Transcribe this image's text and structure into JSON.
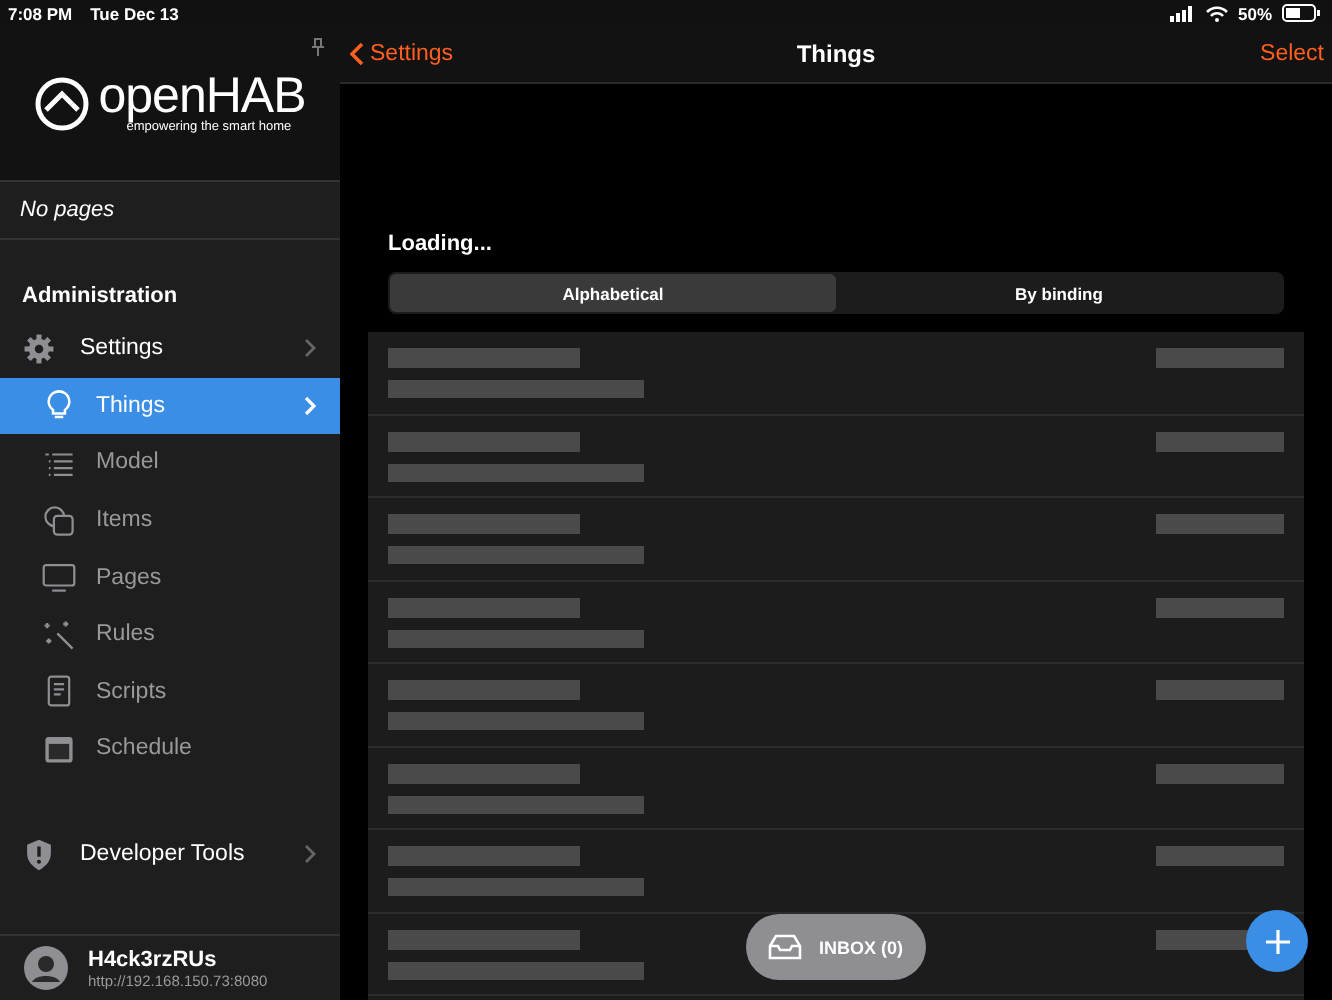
{
  "status_bar": {
    "time": "7:08 PM",
    "date": "Tue Dec 13",
    "battery": "50%"
  },
  "sidebar": {
    "logo": {
      "name": "openHAB",
      "tagline": "empowering the smart home"
    },
    "pages_note": "No pages",
    "section_title": "Administration",
    "items": [
      {
        "label": "Settings",
        "kind": "gear",
        "selected": false,
        "children": [
          {
            "label": "Things",
            "kind": "bulb",
            "selected": true
          },
          {
            "label": "Model",
            "kind": "list",
            "selected": false
          },
          {
            "label": "Items",
            "kind": "squares",
            "selected": false
          },
          {
            "label": "Pages",
            "kind": "monitor",
            "selected": false
          },
          {
            "label": "Rules",
            "kind": "wand",
            "selected": false
          },
          {
            "label": "Scripts",
            "kind": "document",
            "selected": false
          },
          {
            "label": "Schedule",
            "kind": "calendar",
            "selected": false
          }
        ]
      }
    ],
    "developer_tools": {
      "label": "Developer Tools"
    },
    "user": {
      "name": "H4ck3rzRUs",
      "address": "http://192.168.150.73:8080"
    }
  },
  "nav_bar": {
    "back": "Settings",
    "title": "Things",
    "action": "Select"
  },
  "loading_text": "Loading...",
  "tabs": [
    {
      "label": "Alphabetical",
      "selected": true
    },
    {
      "label": "By binding",
      "selected": false
    }
  ],
  "inbox_button": {
    "label": "INBOX (0)"
  }
}
